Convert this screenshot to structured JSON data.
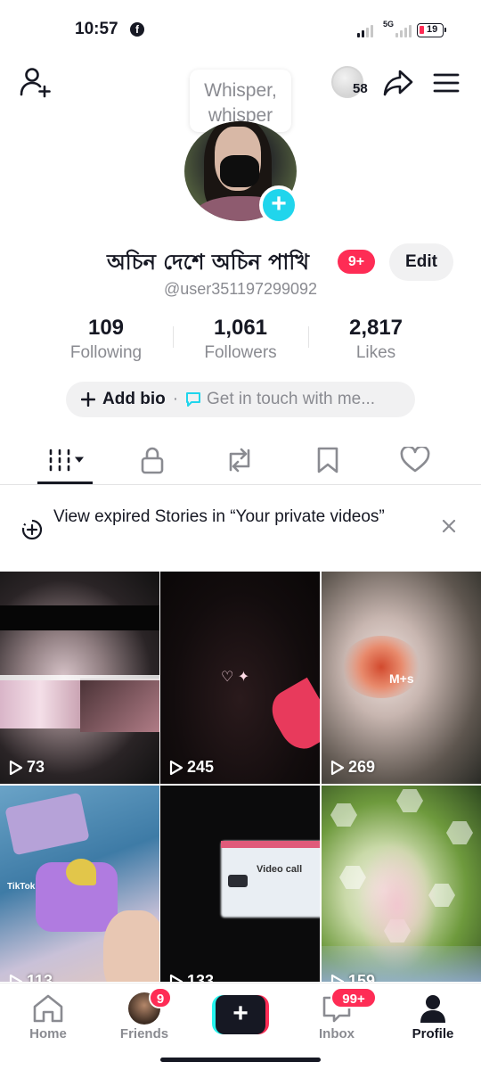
{
  "status_bar": {
    "time": "10:57",
    "network": "5G",
    "battery": "19"
  },
  "header": {
    "coins": "58",
    "whisper_line1": "Whisper,",
    "whisper_line2": "whisper"
  },
  "profile": {
    "name": "অচিন দেশে অচিন পাখি",
    "name_badge": "9+",
    "edit_label": "Edit",
    "username": "@user351197299092"
  },
  "stats": {
    "following": {
      "value": "109",
      "label": "Following"
    },
    "followers": {
      "value": "1,061",
      "label": "Followers"
    },
    "likes": {
      "value": "2,817",
      "label": "Likes"
    }
  },
  "bio": {
    "add_label": "Add bio",
    "separator": "·",
    "touch_label": "Get in touch with me..."
  },
  "tabs": [
    "videos-tab",
    "private-tab",
    "reposts-tab",
    "saved-tab",
    "liked-tab"
  ],
  "banner": {
    "text": "View expired Stories in “Your private videos”"
  },
  "videos": [
    {
      "views": "73"
    },
    {
      "views": "245"
    },
    {
      "views": "269",
      "overlay": "M+s"
    },
    {
      "views": "113",
      "overlay": "TikTok"
    },
    {
      "views": "133",
      "overlay": "Video call"
    },
    {
      "views": "159"
    }
  ],
  "nav": {
    "home": "Home",
    "friends": "Friends",
    "friends_badge": "9",
    "inbox": "Inbox",
    "inbox_badge": "99+",
    "profile": "Profile"
  },
  "colors": {
    "accent": "#fe2c55",
    "cyan": "#20d5ec",
    "text": "#161823",
    "muted": "#8a8b91"
  }
}
